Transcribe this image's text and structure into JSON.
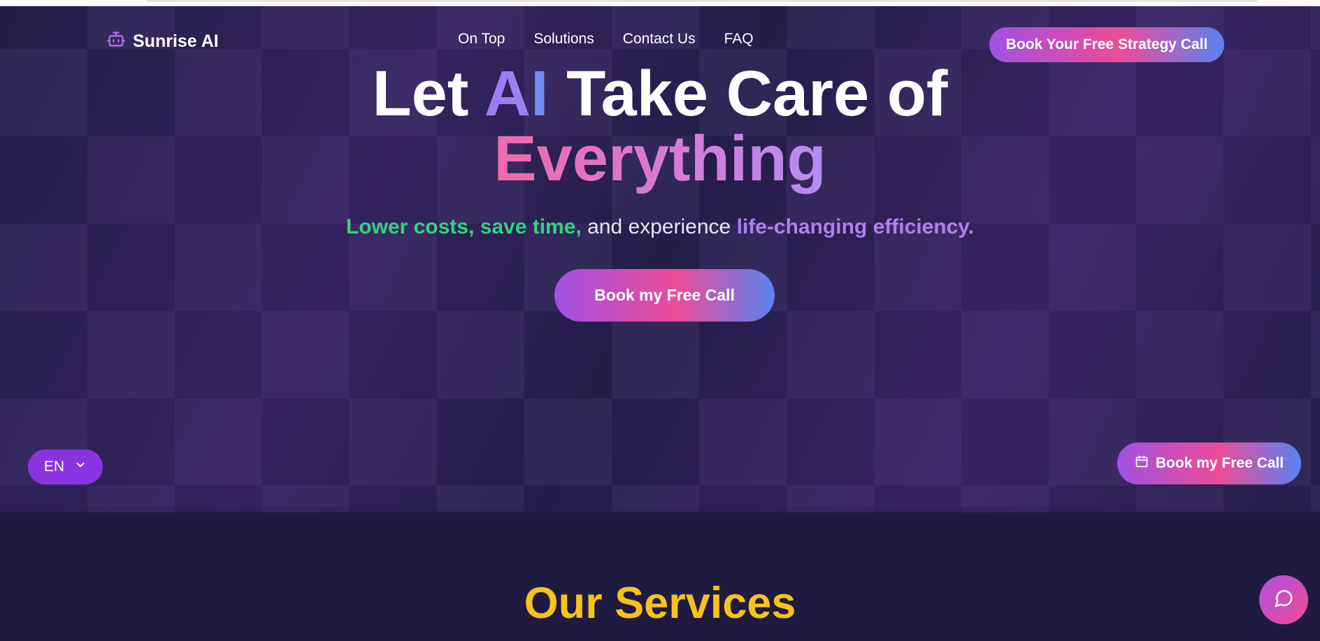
{
  "brand": {
    "name": "Sunrise AI",
    "icon": "robot-icon",
    "accent": "#a151e4"
  },
  "nav": {
    "links": [
      "On Top",
      "Solutions",
      "Contact Us",
      "FAQ"
    ],
    "cta_label": "Book Your Free Strategy Call"
  },
  "hero": {
    "headline": {
      "part1": "Let ",
      "highlight": "AI",
      "part2": " Take Care of",
      "line2": "Everything"
    },
    "subtitle": {
      "green": "Lower costs, save time,",
      "plain": " and experience ",
      "purple": "life-changing efficiency."
    },
    "cta_label": "Book my Free Call"
  },
  "language": {
    "selected": "EN",
    "icon": "chevron-down-icon"
  },
  "floating_cta": {
    "label": "Book my Free Call",
    "icon": "calendar-icon"
  },
  "services": {
    "title": "Our Services"
  },
  "chat": {
    "icon": "chat-bubble-icon"
  },
  "colors": {
    "background": "#1f1b40",
    "hero": "#271f4f",
    "services_title": "#f7c21c",
    "green_text": "#34d27a",
    "purple_text": "#b07ff0"
  }
}
